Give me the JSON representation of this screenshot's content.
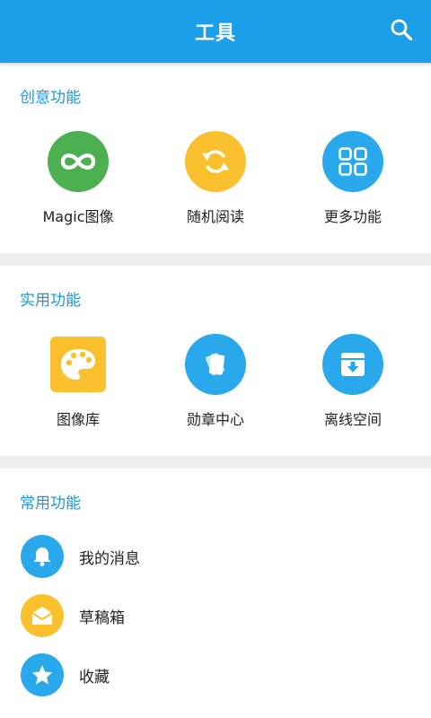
{
  "app_bar": {
    "title": "工具",
    "search_icon": "search-icon"
  },
  "sections": [
    {
      "title": "创意功能",
      "items": [
        {
          "label": "Magic图像",
          "icon": "infinity-icon",
          "color": "#4caf50"
        },
        {
          "label": "随机阅读",
          "icon": "refresh-icon",
          "color": "#fbc02d"
        },
        {
          "label": "更多功能",
          "icon": "grid-icon",
          "color": "#29a9ec"
        }
      ]
    },
    {
      "title": "实用功能",
      "items": [
        {
          "label": "图像库",
          "icon": "palette-icon",
          "color": "#fbc02d"
        },
        {
          "label": "勋章中心",
          "icon": "cards-icon",
          "color": "#29a9ec"
        },
        {
          "label": "离线空间",
          "icon": "download-box-icon",
          "color": "#29a9ec"
        }
      ]
    },
    {
      "title": "常用功能",
      "items": [
        {
          "label": "我的消息",
          "icon": "bell-icon",
          "color": "#29a9ec"
        },
        {
          "label": "草稿箱",
          "icon": "envelope-open-icon",
          "color": "#fbc02d"
        },
        {
          "label": "收藏",
          "icon": "star-icon",
          "color": "#29a9ec"
        }
      ]
    }
  ],
  "colors": {
    "primary": "#1a9fe8",
    "section_title": "#2196d8",
    "background": "#efefef"
  }
}
